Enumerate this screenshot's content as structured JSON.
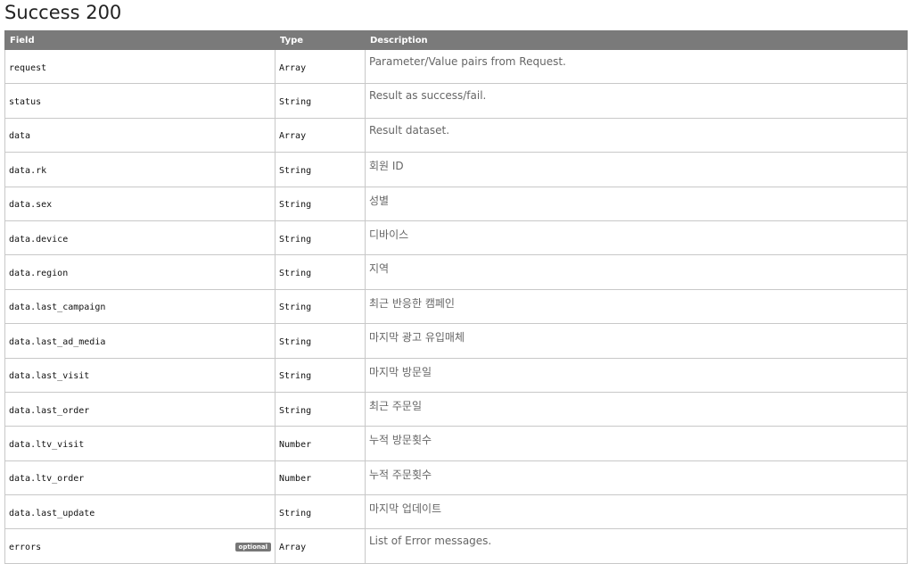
{
  "title": "Success 200",
  "headers": {
    "field": "Field",
    "type": "Type",
    "description": "Description"
  },
  "rows": [
    {
      "field": "request",
      "type": "Array",
      "description": "Parameter/Value pairs from Request.",
      "badge": ""
    },
    {
      "field": "status",
      "type": "String",
      "description": "Result as success/fail.",
      "badge": ""
    },
    {
      "field": "data",
      "type": "Array",
      "description": "Result dataset.",
      "badge": ""
    },
    {
      "field": "data.rk",
      "type": "String",
      "description": "회원 ID",
      "badge": ""
    },
    {
      "field": "data.sex",
      "type": "String",
      "description": "성별",
      "badge": ""
    },
    {
      "field": "data.device",
      "type": "String",
      "description": "디바이스",
      "badge": ""
    },
    {
      "field": "data.region",
      "type": "String",
      "description": "지역",
      "badge": ""
    },
    {
      "field": "data.last_campaign",
      "type": "String",
      "description": "최근 반응한 캠페인",
      "badge": ""
    },
    {
      "field": "data.last_ad_media",
      "type": "String",
      "description": "마지막 광고 유입매체",
      "badge": ""
    },
    {
      "field": "data.last_visit",
      "type": "String",
      "description": "마지막 방문일",
      "badge": ""
    },
    {
      "field": "data.last_order",
      "type": "String",
      "description": "최근 주문일",
      "badge": ""
    },
    {
      "field": "data.ltv_visit",
      "type": "Number",
      "description": "누적 방문횟수",
      "badge": ""
    },
    {
      "field": "data.ltv_order",
      "type": "Number",
      "description": "누적 주문횟수",
      "badge": ""
    },
    {
      "field": "data.last_update",
      "type": "String",
      "description": "마지막 업데이트",
      "badge": ""
    },
    {
      "field": "errors",
      "type": "Array",
      "description": "List of Error messages.",
      "badge": "optional"
    }
  ]
}
